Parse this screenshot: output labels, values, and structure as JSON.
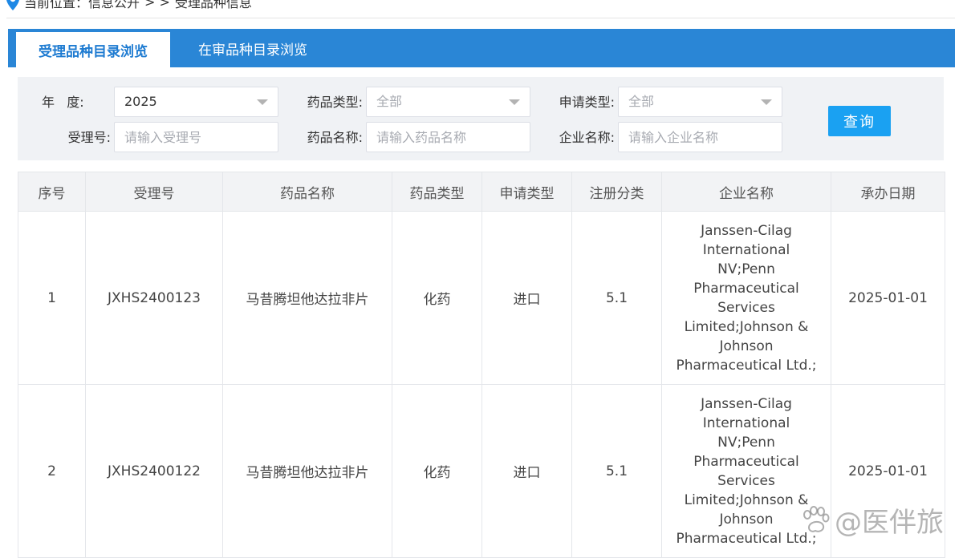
{
  "breadcrumb": {
    "prefix": "当前位置：信息公开",
    "separator": "> >",
    "current": "受理品种信息"
  },
  "tabs": [
    {
      "label": "受理品种目录浏览",
      "active": true
    },
    {
      "label": "在审品种目录浏览",
      "active": false
    }
  ],
  "filters": {
    "year_label": "年   度:",
    "year_value": "2025",
    "drug_type_label": "药品类型:",
    "drug_type_value": "全部",
    "apply_type_label": "申请类型:",
    "apply_type_value": "全部",
    "accept_no_label": "受理号:",
    "accept_no_placeholder": "请输入受理号",
    "drug_name_label": "药品名称:",
    "drug_name_placeholder": "请输入药品名称",
    "company_label": "企业名称:",
    "company_placeholder": "请输入企业名称",
    "query_label": "查询"
  },
  "table": {
    "headers": [
      "序号",
      "受理号",
      "药品名称",
      "药品类型",
      "申请类型",
      "注册分类",
      "企业名称",
      "承办日期"
    ],
    "rows": [
      {
        "index": "1",
        "accept_no": "JXHS2400123",
        "drug_name": "马昔腾坦他达拉非片",
        "drug_type": "化药",
        "apply_type": "进口",
        "reg_class": "5.1",
        "company_lines": [
          "Janssen-Cilag",
          "International",
          "NV;Penn",
          "Pharmaceutical",
          "Services",
          "Limited;Johnson &",
          "Johnson",
          "Pharmaceutical Ltd.;"
        ],
        "date": "2025-01-01"
      },
      {
        "index": "2",
        "accept_no": "JXHS2400122",
        "drug_name": "马昔腾坦他达拉非片",
        "drug_type": "化药",
        "apply_type": "进口",
        "reg_class": "5.1",
        "company_lines": [
          "Janssen-Cilag",
          "International",
          "NV;Penn",
          "Pharmaceutical",
          "Services",
          "Limited;Johnson &",
          "Johnson",
          "Pharmaceutical Ltd.;"
        ],
        "date": "2025-01-01"
      }
    ]
  },
  "watermark": {
    "text": "@医伴旅",
    "icon": "paw-icon"
  },
  "colors": {
    "tab_bar": "#2a86d6",
    "active_tab_text": "#1e7bd1",
    "query_button": "#1aa1f2",
    "filter_bg": "#f0f2f5",
    "location_pin": "#1e88e5"
  }
}
